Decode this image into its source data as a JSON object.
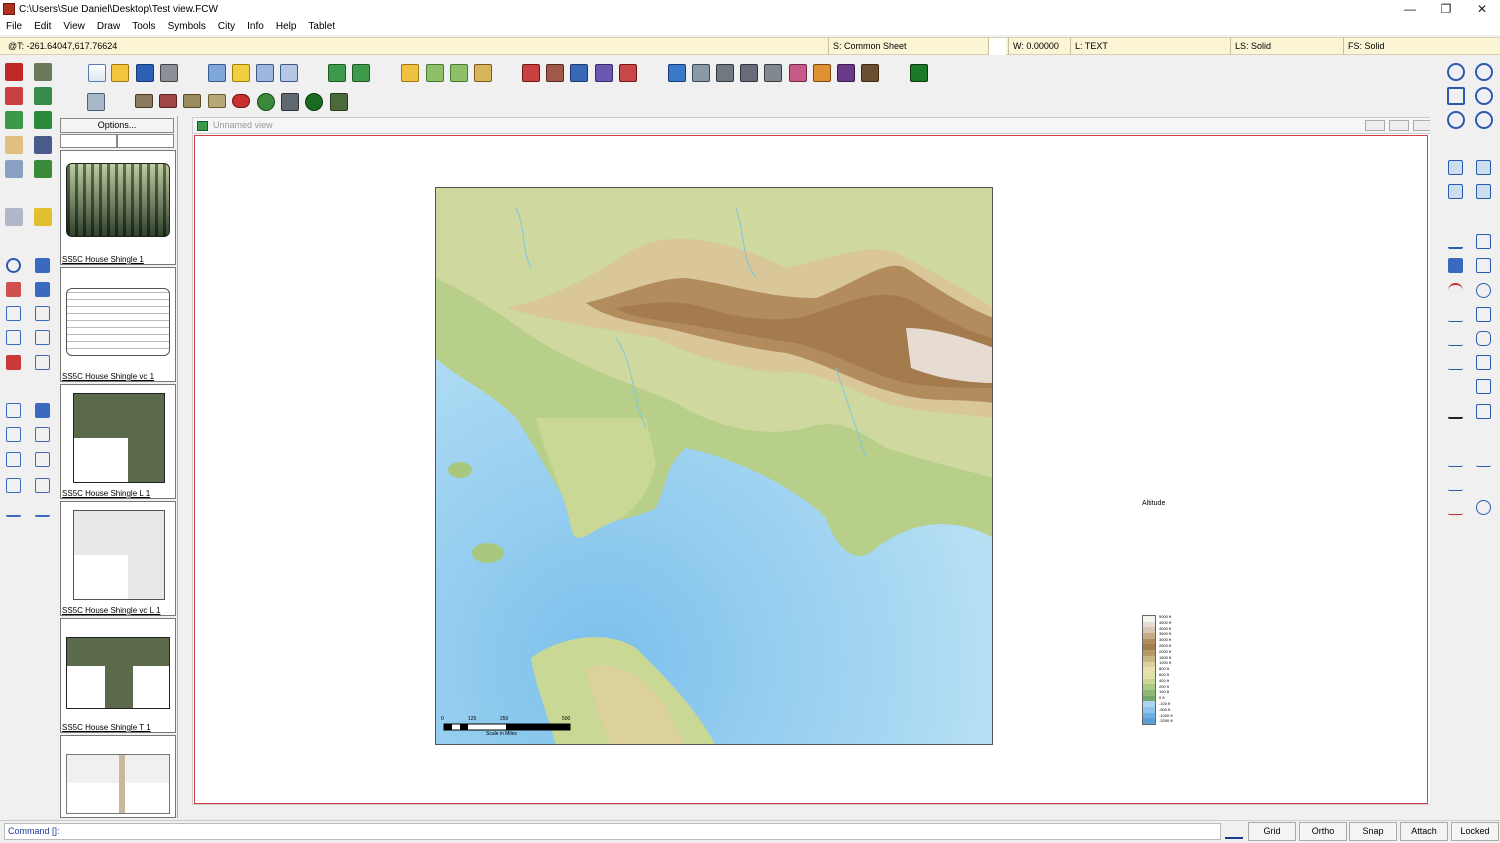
{
  "window": {
    "title": "C:\\Users\\Sue Daniel\\Desktop\\Test view.FCW",
    "minimize": "—",
    "maximize": "❐",
    "close": "✕"
  },
  "menu": [
    "File",
    "Edit",
    "View",
    "Draw",
    "Tools",
    "Symbols",
    "City",
    "Info",
    "Help",
    "Tablet"
  ],
  "status": {
    "coords": "@T: -261.64047,617.76624",
    "sheet": "S: Common Sheet",
    "width": "W: 0.00000",
    "layer": "L: TEXT",
    "line_style": "LS: Solid",
    "fill_style": "FS: Solid"
  },
  "symbols": {
    "options_label": "Options...",
    "items": [
      {
        "label": "SS5C House Shingle 1"
      },
      {
        "label": "SS5C House Shingle vc 1"
      },
      {
        "label": "SS5C House Shingle L 1"
      },
      {
        "label": "SS5C House Shingle vc L 1"
      },
      {
        "label": "SS5C House Shingle T 1"
      },
      {
        "label": ""
      }
    ]
  },
  "document": {
    "title": "Unnamed view"
  },
  "map": {
    "scale_ticks": [
      "0",
      "125",
      "250",
      "500"
    ],
    "scale_caption": "Scale in Miles"
  },
  "legend": {
    "title": "Altitude",
    "colors": [
      "#f4f4f0",
      "#e6dcd2",
      "#d9c7b3",
      "#c8ab86",
      "#b38c5e",
      "#a47b4c",
      "#b59a68",
      "#c9b683",
      "#dcd09b",
      "#e8e1ae",
      "#dfe2a6",
      "#c9d894",
      "#abca85",
      "#8eb876",
      "#74a86a",
      "#a8d4ee",
      "#8cc4ea",
      "#70b0e0",
      "#5a9ed6"
    ],
    "labels": [
      "5000 ft",
      "4500 ft",
      "4000 ft",
      "3500 ft",
      "3000 ft",
      "2500 ft",
      "2000 ft",
      "1500 ft",
      "1000 ft",
      "800 ft",
      "600 ft",
      "400 ft",
      "200 ft",
      "100 ft",
      "0 ft",
      "-100 ft",
      "-500 ft",
      "-1000 ft",
      "-2000 ft"
    ]
  },
  "command": {
    "prompt": "Command []:",
    "buttons": [
      "Grid",
      "Ortho",
      "Snap",
      "Attach",
      "Locked"
    ]
  }
}
